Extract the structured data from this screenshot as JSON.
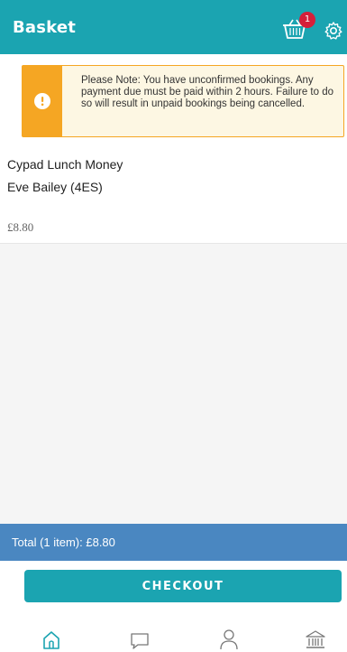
{
  "header": {
    "title": "Basket",
    "basket_count": "1"
  },
  "notice": {
    "text": "Please Note: You have unconfirmed bookings. Any payment due must be paid within 2 hours. Failure to do so will result in unpaid bookings being cancelled."
  },
  "item": {
    "title": "Cypad Lunch Money",
    "subtitle": "Eve Bailey (4ES)",
    "price": "£8.80"
  },
  "total": {
    "text": "Total (1 item): £8.80"
  },
  "checkout": {
    "label": "CHECKOUT"
  },
  "nav": {
    "items": [
      "home-icon",
      "chat-icon",
      "user-icon",
      "bank-icon"
    ]
  },
  "colors": {
    "primary": "#1ba4b1",
    "total_bar": "#4a87c1",
    "warning": "#f5a623",
    "badge": "#d61f3a"
  }
}
